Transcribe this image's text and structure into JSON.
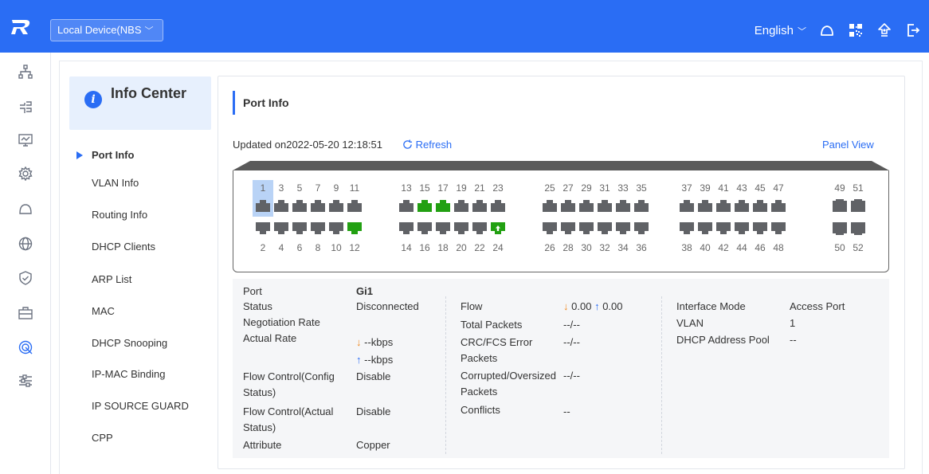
{
  "header": {
    "device_select": "Local Device(NBS",
    "language": "English",
    "icons": [
      "cloud-icon",
      "qr-code-icon",
      "upgrade-icon",
      "logout-icon"
    ],
    "bg_color": "#2a6df4"
  },
  "rail": {
    "icons": [
      "topology-icon",
      "network-icon",
      "monitor-icon",
      "settings-icon",
      "cloud-icon",
      "globe-icon",
      "shield-icon",
      "toolbox-icon",
      "info-center-icon",
      "advanced-icon"
    ],
    "active": "info-center-icon"
  },
  "sidebar": {
    "title": "Info Center",
    "items": [
      {
        "label": "Port Info",
        "active": true
      },
      {
        "label": "VLAN Info"
      },
      {
        "label": "Routing Info"
      },
      {
        "label": "DHCP Clients"
      },
      {
        "label": "ARP List"
      },
      {
        "label": "MAC"
      },
      {
        "label": "DHCP Snooping"
      },
      {
        "label": "IP-MAC Binding"
      },
      {
        "label": "IP SOURCE GUARD"
      },
      {
        "label": "CPP"
      }
    ]
  },
  "main": {
    "title": "Port Info",
    "updated": "Updated on2022-05-20 12:18:51",
    "refresh": "Refresh",
    "panel_view": "Panel View"
  },
  "panel": {
    "top_numbers": [
      "1",
      "3",
      "5",
      "7",
      "9",
      "11",
      "13",
      "15",
      "17",
      "19",
      "21",
      "23",
      "25",
      "27",
      "29",
      "31",
      "33",
      "35",
      "37",
      "39",
      "41",
      "43",
      "45",
      "47",
      "49",
      "51"
    ],
    "bottom_numbers": [
      "2",
      "4",
      "6",
      "8",
      "10",
      "12",
      "14",
      "16",
      "18",
      "20",
      "22",
      "24",
      "26",
      "28",
      "30",
      "32",
      "34",
      "36",
      "38",
      "40",
      "42",
      "44",
      "46",
      "48",
      "50",
      "52"
    ],
    "connected_ports": [
      "12",
      "15",
      "17",
      "24"
    ],
    "uplink_port": "24",
    "selected_port": "1",
    "colors": {
      "connected": "#22a012",
      "disconnected": "#606266",
      "selected_bg": "#b9d3f6"
    }
  },
  "details": {
    "col1": {
      "port_label": "Port",
      "port_value": "Gi1",
      "status_label": "Status",
      "status_value": "Disconnected",
      "neg_rate_label": "Negotiation Rate",
      "actual_rate_label": "Actual Rate",
      "actual_rate_down": "--kbps",
      "actual_rate_up": "--kbps",
      "fc_config_label": "Flow Control(Config Status)",
      "fc_config_value": "Disable",
      "fc_actual_label": "Flow Control(Actual Status)",
      "fc_actual_value": "Disable",
      "attribute_label": "Attribute",
      "attribute_value": "Copper"
    },
    "col2": {
      "flow_label": "Flow",
      "flow_down": "0.00",
      "flow_up": "0.00",
      "total_packets_label": "Total Packets",
      "total_packets_value": "--/--",
      "crc_label": "CRC/FCS Error Packets",
      "crc_value": "--/--",
      "corrupted_label": "Corrupted/Oversized Packets",
      "corrupted_value": "--/--",
      "conflicts_label": "Conflicts",
      "conflicts_value": "--"
    },
    "col3": {
      "mode_label": "Interface Mode",
      "mode_value": "Access Port",
      "vlan_label": "VLAN",
      "vlan_value": "1",
      "pool_label": "DHCP Address Pool",
      "pool_value": "--"
    }
  }
}
